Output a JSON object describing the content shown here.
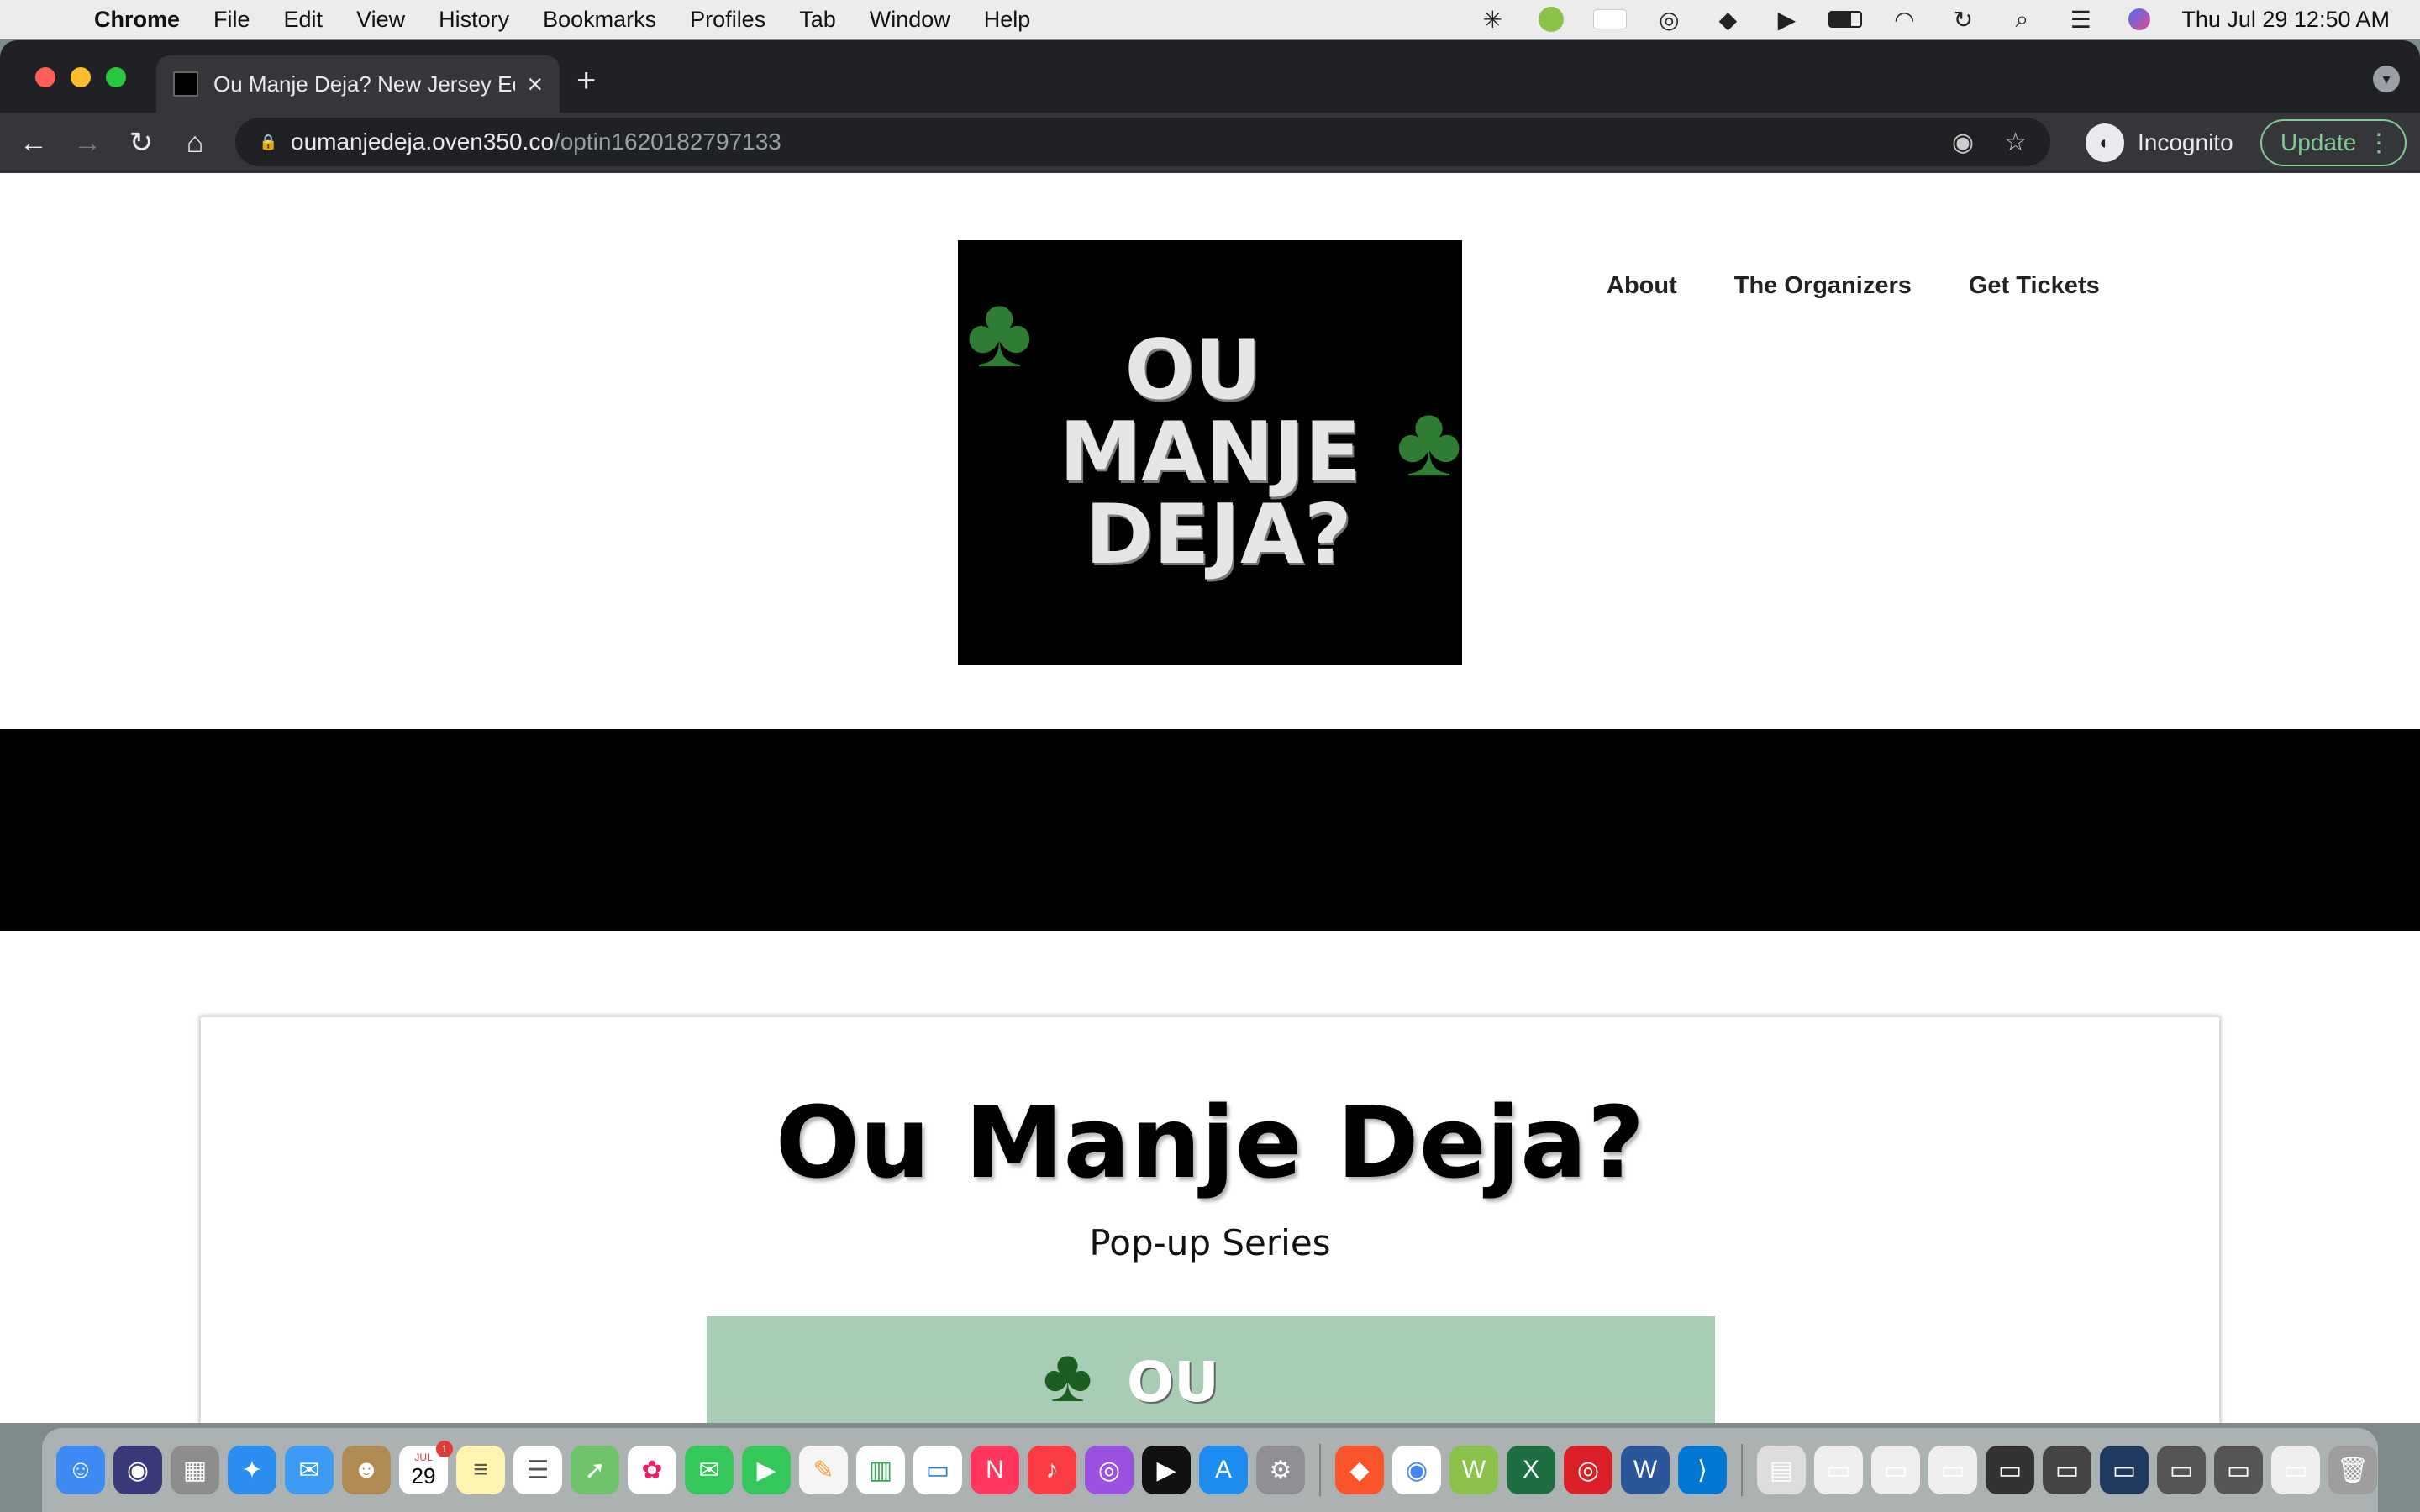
{
  "menubar": {
    "app_name": "Chrome",
    "items": [
      "File",
      "Edit",
      "View",
      "History",
      "Bookmarks",
      "Profiles",
      "Tab",
      "Window",
      "Help"
    ],
    "clock": "Thu Jul 29  12:50 AM"
  },
  "browser": {
    "tab_title": "Ou Manje Deja? New Jersey Ed",
    "url_host": "oumanjedeja.oven350.co",
    "url_path": "/optin1620182797133",
    "incognito_label": "Incognito",
    "update_label": "Update"
  },
  "site": {
    "logo_lines": [
      "OU",
      "MANJE",
      "DEJA?"
    ],
    "nav": {
      "about": "About",
      "organizers": "The Organizers",
      "tickets": "Get Tickets"
    }
  },
  "card": {
    "title": "Ou Manje Deja?",
    "subtitle": "Pop-up Series",
    "image_text": "OU"
  },
  "dock": {
    "calendar_month": "JUL",
    "calendar_day": "29",
    "calendar_badge": "1"
  },
  "colors": {
    "chrome_dark": "#202124",
    "toolbar": "#35363a",
    "update_green": "#81c995",
    "band_black": "#000000",
    "card_image_green": "#a7ceb4"
  }
}
